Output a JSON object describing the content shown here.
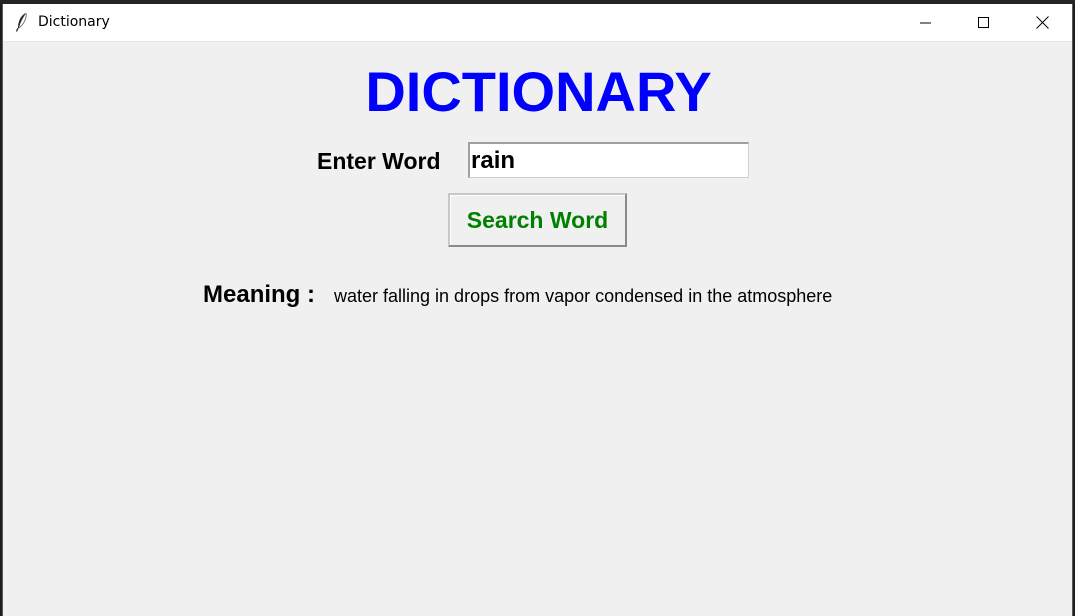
{
  "window": {
    "title": "Dictionary"
  },
  "controls": {
    "minimize_icon": "minimize-icon",
    "maximize_icon": "maximize-icon",
    "close_icon": "close-icon"
  },
  "app": {
    "heading": "DICTIONARY",
    "enter_word_label": "Enter Word",
    "word_input_value": "rain",
    "search_button_label": "Search Word",
    "meaning_label": "Meaning :",
    "meaning_text": "water falling in drops from vapor condensed in the atmosphere"
  },
  "colors": {
    "heading": "#0000ff",
    "button_text": "#008000",
    "window_background": "#f0f0f0"
  }
}
